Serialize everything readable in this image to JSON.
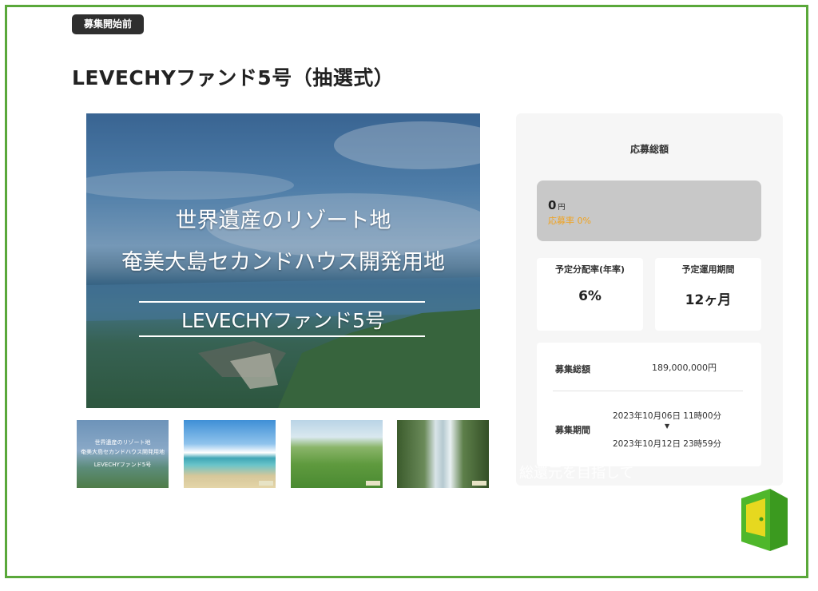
{
  "status_badge": "募集開始前",
  "fund_title": "LEVECHYファンド5号（抽選式）",
  "hero": {
    "line1": "世界遺産のリゾート地",
    "line2": "奄美大島セカンドハウス開発用地",
    "line3": "LEVECHYファンド5号"
  },
  "thumbnails": [
    {
      "line1": "世界遺産のリゾート地",
      "line2": "奄美大島セカンドハウス開発用地",
      "line3": "LEVECHYファンド5号"
    },
    {},
    {},
    {}
  ],
  "panel": {
    "heading": "応募総額",
    "amount": "0",
    "amount_unit": "円",
    "rate_text": "応募率 0%",
    "rate_color": "#f0a21e",
    "cards": [
      {
        "label": "予定分配率(年率)",
        "value": "6%"
      },
      {
        "label": "予定運用期間",
        "value": "12ヶ月"
      }
    ],
    "info": {
      "total_label": "募集総額",
      "total_value": "189,000,000円",
      "period_label": "募集期間",
      "period_start": "2023年10月06日 11時00分",
      "period_arrow": "▼",
      "period_end": "2023年10月12日 23時59分"
    }
  },
  "ghost_text": "総還元を目指して",
  "colors": {
    "frame_border": "#5aa83a",
    "badge_bg": "#2f2f2f",
    "logo_green": "#4fb72b",
    "logo_yellow": "#e6d81f"
  }
}
